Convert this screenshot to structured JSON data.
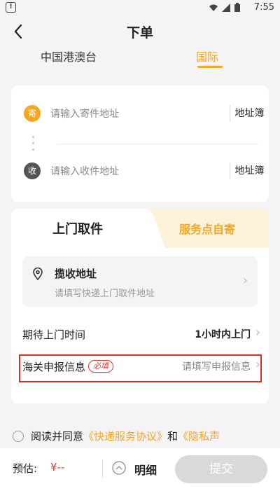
{
  "status_bar": {
    "time": "7:55",
    "warning_glyph": "!"
  },
  "header": {
    "title": "下单",
    "tabs": [
      {
        "label": "中国港澳台",
        "active": false
      },
      {
        "label": "国际",
        "active": true
      }
    ]
  },
  "addresses": {
    "sender": {
      "badge": "寄",
      "placeholder": "请输入寄件地址",
      "book_label": "地址簿"
    },
    "receiver": {
      "badge": "收",
      "placeholder": "请输入收件地址",
      "book_label": "地址簿"
    }
  },
  "pickup": {
    "tabs": [
      {
        "label": "上门取件",
        "active": true
      },
      {
        "label": "服务点自寄",
        "active": false
      }
    ],
    "address": {
      "title": "揽收地址",
      "placeholder": "请填写快递上门取件地址"
    },
    "time_row": {
      "label": "期待上门时间",
      "value": "1小时内上门"
    },
    "customs_row": {
      "label": "海关申报信息",
      "required": "必填",
      "value": "请填写申报信息"
    }
  },
  "agreement": {
    "prefix": "阅读并同意",
    "link1": "《快递服务协议》",
    "and": "和",
    "link2": "《隐私声"
  },
  "footer": {
    "estimate_label": "预估:",
    "estimate_value": "¥--",
    "detail_label": "明细",
    "submit_label": "提交"
  },
  "colors": {
    "accent": "#f5a623",
    "price": "#e53935",
    "highlight_border": "#d32f2f",
    "disabled": "#d9d9d9"
  }
}
